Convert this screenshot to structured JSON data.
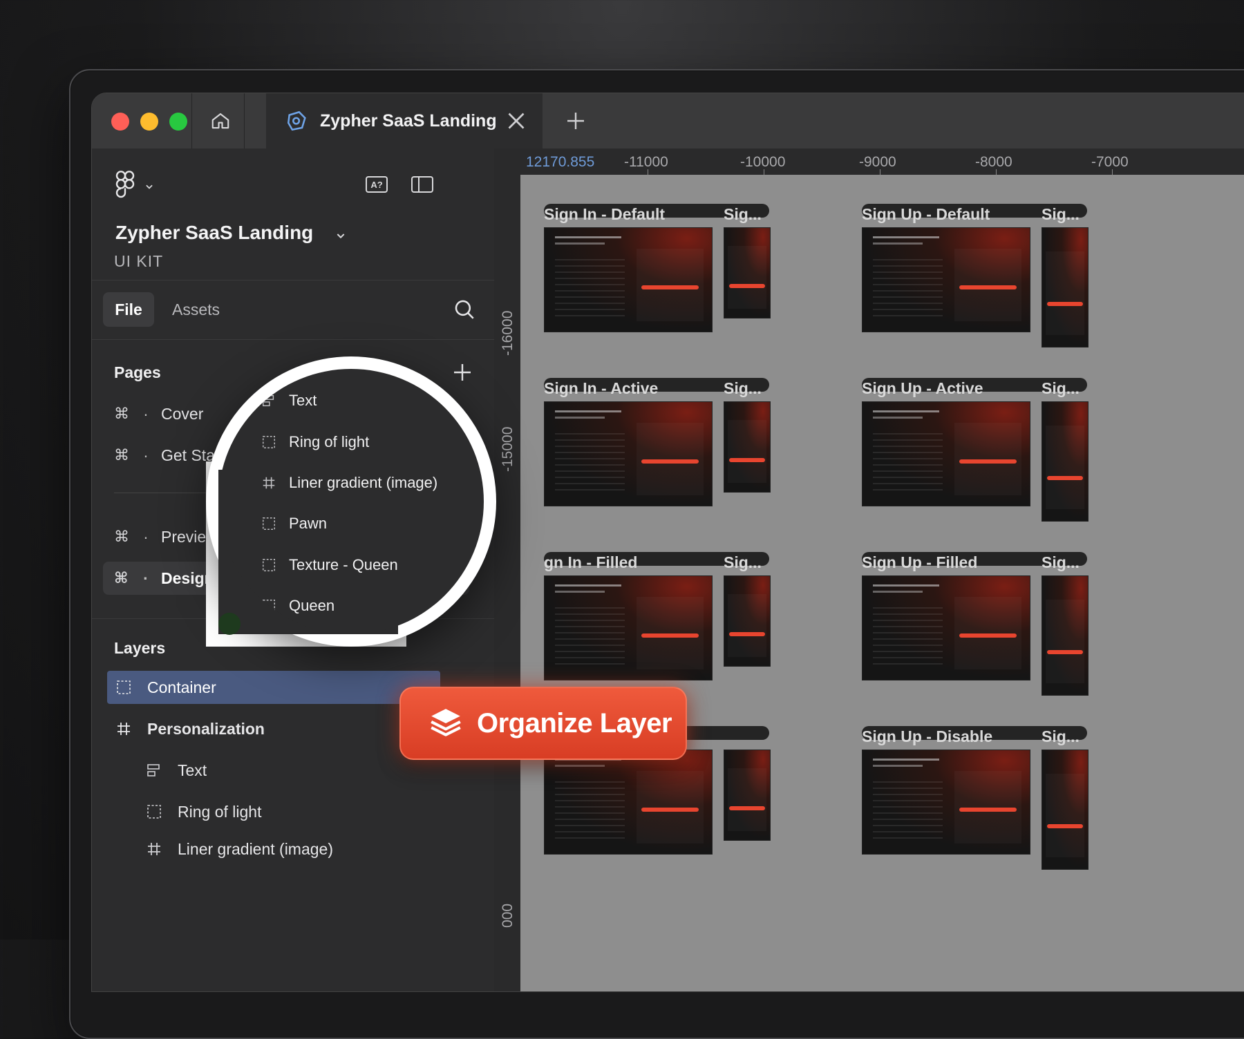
{
  "window": {
    "tab_title": "Zypher SaaS Landing"
  },
  "sidebar": {
    "file_name": "Zypher SaaS Landing",
    "file_subtitle": "UI KIT",
    "tabs": [
      {
        "label": "File"
      },
      {
        "label": "Assets"
      }
    ],
    "pages_label": "Pages",
    "pages": [
      {
        "cmd": "⌘",
        "bullet": "·",
        "label": "Cover"
      },
      {
        "cmd": "⌘",
        "bullet": "·",
        "label": "Get Started"
      },
      {
        "cmd": "⌘",
        "bullet": "·",
        "label": "Preview"
      },
      {
        "cmd": "⌘",
        "bullet": "·",
        "label": "Design"
      }
    ],
    "layers_label": "Layers",
    "layers": [
      {
        "label": "Container",
        "icon": "dashed-frame-icon"
      },
      {
        "label": "Personalization",
        "icon": "frame-hash-icon"
      },
      {
        "label": "Text",
        "icon": "text-layer-icon"
      },
      {
        "label": "Ring of light",
        "icon": "dashed-frame-icon"
      },
      {
        "label": "Liner gradient (image)",
        "icon": "frame-hash-icon"
      }
    ]
  },
  "magnifier": {
    "items": [
      {
        "label": "Text",
        "icon": "text-layer-icon"
      },
      {
        "label": "Ring of light",
        "icon": "dashed-frame-icon"
      },
      {
        "label": "Liner gradient (image)",
        "icon": "frame-hash-icon"
      },
      {
        "label": "Pawn",
        "icon": "dashed-frame-icon"
      },
      {
        "label": "Texture - Queen",
        "icon": "dashed-frame-icon"
      },
      {
        "label": "Queen",
        "icon": "dashed-frame-icon"
      }
    ]
  },
  "ruler": {
    "horizontal": [
      "12170.855",
      "-11000",
      "-10000",
      "-9000",
      "-8000",
      "-7000"
    ],
    "vertical": [
      "-16000",
      "-15000",
      "000"
    ]
  },
  "canvas": {
    "frames": [
      {
        "label": "Sign In - Default",
        "short": "Sig..."
      },
      {
        "label": "Sign Up - Default",
        "short": "Sig..."
      },
      {
        "label": "Sign In - Active",
        "short": "Sig..."
      },
      {
        "label": "Sign Up - Active",
        "short": "Sig..."
      },
      {
        "label": "gn In - Filled",
        "short": "Sig..."
      },
      {
        "label": "Sign Up - Filled",
        "short": "Sig..."
      },
      {
        "label": "",
        "short": ""
      },
      {
        "label": "Sign Up - Disable",
        "short": "Sig..."
      }
    ]
  },
  "cta": {
    "label": "Organize Layer"
  },
  "colors": {
    "accent": "#e8452f",
    "selection": "#4a5a80"
  }
}
